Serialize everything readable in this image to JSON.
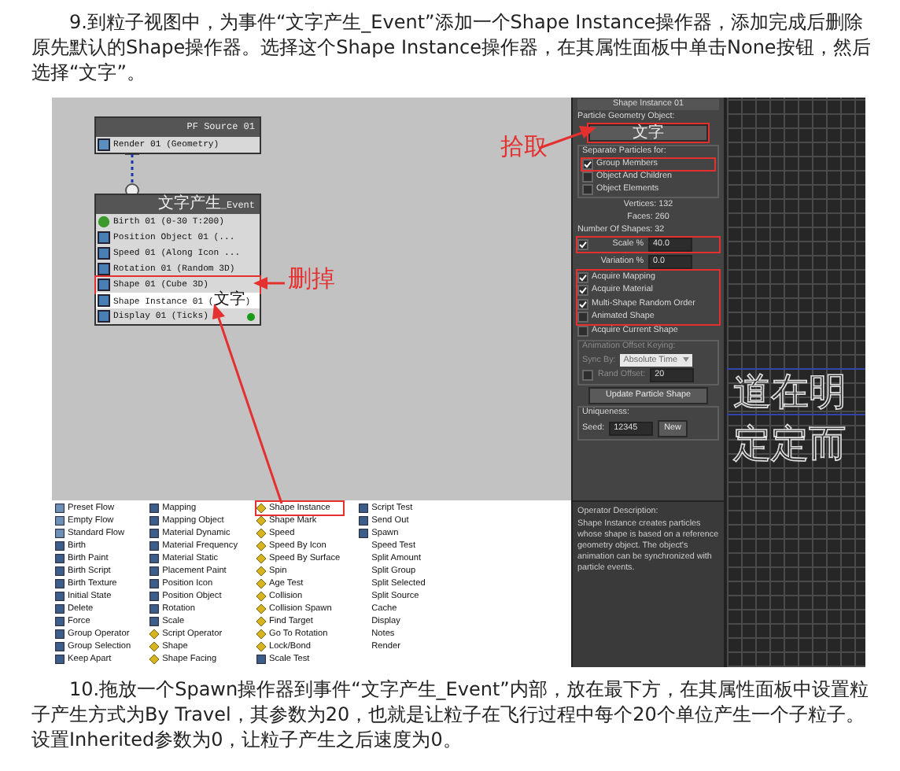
{
  "paragraphs": [
    "9.到粒子视图中，为事件“文字产生_Event”添加一个Shape Instance操作器，添加完成后删除原先默认的Shape操作器。选择这个Shape Instance操作器，在其属性面板中单击None按钮，然后选择“文字”。",
    "10.拖放一个Spawn操作器到事件“文字产生_Event”内部，放在最下方，在其属性面板中设置粒子产生方式为By Travel，其参数为20，也就是让粒子在飞行过程中每个20个单位产生一个子粒子。设置Inherited参数为0，让粒子产生之后速度为0。"
  ],
  "particle_view": {
    "nodes": [
      {
        "title": "PF Source 01",
        "operators": [
          {
            "label": "Render 01 (Geometry)",
            "kind": "render",
            "selected": false,
            "boxed": false
          }
        ]
      },
      {
        "title": "文字产生_Event",
        "operators": [
          {
            "label": "Birth 01 (0-30 T:200)",
            "kind": "birth",
            "selected": false,
            "boxed": false
          },
          {
            "label": "Position Object 01 (...",
            "kind": "operator",
            "selected": false,
            "boxed": false
          },
          {
            "label": "Speed 01 (Along Icon ...",
            "kind": "operator",
            "selected": false,
            "boxed": false
          },
          {
            "label": "Rotation 01 (Random 3D)",
            "kind": "operator",
            "selected": false,
            "boxed": false
          },
          {
            "label": "Shape 01 (Cube 3D)",
            "kind": "operator",
            "selected": false,
            "boxed": true
          },
          {
            "label": "Shape Instance 01 (文字)",
            "kind": "operator",
            "selected": true,
            "boxed": false
          },
          {
            "label": "Display 01 (Ticks)",
            "kind": "display",
            "selected": false,
            "boxed": false
          }
        ]
      }
    ]
  },
  "annotations": [
    "删掉",
    "拾取"
  ],
  "command_panel": {
    "rollout_title": "Shape Instance 01",
    "geometry_label": "Particle Geometry Object:",
    "geometry_button": {
      "label": "文字",
      "boxed": true
    },
    "separate_label": "Separate Particles for:",
    "separate_options": [
      {
        "label": "Group Members",
        "checked": true,
        "boxed": true
      },
      {
        "label": "Object And Children",
        "checked": false,
        "boxed": false
      },
      {
        "label": "Object Elements",
        "checked": false,
        "boxed": false
      }
    ],
    "stats": [
      "Vertices: 132",
      "Faces: 260"
    ],
    "shapes_label": "Number Of Shapes: 32",
    "spinners": [
      {
        "kind": "checked",
        "label": "Scale %",
        "checked": true,
        "value": "40.0",
        "boxed": true
      },
      {
        "kind": "plain",
        "label": "Variation %",
        "value": "0.0",
        "boxed": false
      }
    ],
    "acquire_boxed": true,
    "acquire_options": [
      {
        "label": "Acquire Mapping",
        "checked": true
      },
      {
        "label": "Acquire Material",
        "checked": true
      },
      {
        "label": "Multi-Shape Random Order",
        "checked": true
      },
      {
        "label": "Animated Shape",
        "checked": false
      }
    ],
    "current_option": {
      "label": "Acquire Current Shape",
      "checked": false
    },
    "offset_group": {
      "label": "Animation Offset Keying:",
      "disabled": true,
      "sync_label": "Sync By:",
      "sync_value": "Absolute Time",
      "rand_label": "Rand Offset:",
      "rand_checked": false,
      "rand_value": "20"
    },
    "update_button": "Update Particle Shape",
    "uniqueness": {
      "label": "Uniqueness:",
      "seed_label": "Seed:",
      "seed_value": "12345",
      "new_button": "New"
    }
  },
  "description": {
    "title": "Operator Description:",
    "text": "Shape Instance creates particles whose shape is based on a reference geometry object. The object's animation can be synchronized with particle events."
  },
  "viewport": {
    "lines": [
      {
        "text": "道在明",
        "highlighted": true
      },
      {
        "text": "定定而",
        "highlighted": false
      }
    ]
  },
  "depot": {
    "items": [
      {
        "label": "Preset Flow",
        "kind": "flow",
        "boxed": false
      },
      {
        "label": "Empty Flow",
        "kind": "flow",
        "boxed": false
      },
      {
        "label": "Standard Flow",
        "kind": "flow",
        "boxed": false
      },
      {
        "label": "Birth",
        "kind": "operator",
        "boxed": false
      },
      {
        "label": "Birth Paint",
        "kind": "operator",
        "boxed": false
      },
      {
        "label": "Birth Script",
        "kind": "operator",
        "boxed": false
      },
      {
        "label": "Birth Texture",
        "kind": "operator",
        "boxed": false
      },
      {
        "label": "Initial State",
        "kind": "operator",
        "boxed": false
      },
      {
        "label": "Delete",
        "kind": "operator",
        "boxed": false
      },
      {
        "label": "Force",
        "kind": "operator",
        "boxed": false
      },
      {
        "label": "Group Operator",
        "kind": "operator",
        "boxed": false
      },
      {
        "label": "Group Selection",
        "kind": "operator",
        "boxed": false
      },
      {
        "label": "Keep Apart",
        "kind": "operator",
        "boxed": false
      },
      {
        "label": "Mapping",
        "kind": "operator",
        "boxed": false
      },
      {
        "label": "Mapping Object",
        "kind": "operator",
        "boxed": false
      },
      {
        "label": "Material Dynamic",
        "kind": "operator",
        "boxed": false
      },
      {
        "label": "Material Frequency",
        "kind": "operator",
        "boxed": false
      },
      {
        "label": "Material Static",
        "kind": "operator",
        "boxed": false
      },
      {
        "label": "Placement Paint",
        "kind": "operator",
        "boxed": false
      },
      {
        "label": "Position Icon",
        "kind": "operator",
        "boxed": false
      },
      {
        "label": "Position Object",
        "kind": "operator",
        "boxed": false
      },
      {
        "label": "Rotation",
        "kind": "operator",
        "boxed": false
      },
      {
        "label": "Scale",
        "kind": "operator",
        "boxed": false
      },
      {
        "label": "Script Operator",
        "kind": "test",
        "boxed": false
      },
      {
        "label": "Shape",
        "kind": "test",
        "boxed": false
      },
      {
        "label": "Shape Facing",
        "kind": "test",
        "boxed": false
      },
      {
        "label": "Shape Instance",
        "kind": "test",
        "boxed": true
      },
      {
        "label": "Shape Mark",
        "kind": "test",
        "boxed": false
      },
      {
        "label": "Speed",
        "kind": "test",
        "boxed": false
      },
      {
        "label": "Speed By Icon",
        "kind": "test",
        "boxed": false
      },
      {
        "label": "Speed By Surface",
        "kind": "test",
        "boxed": false
      },
      {
        "label": "Spin",
        "kind": "test",
        "boxed": false
      },
      {
        "label": "Age Test",
        "kind": "test",
        "boxed": false
      },
      {
        "label": "Collision",
        "kind": "test",
        "boxed": false
      },
      {
        "label": "Collision Spawn",
        "kind": "test",
        "boxed": false
      },
      {
        "label": "Find Target",
        "kind": "test",
        "boxed": false
      },
      {
        "label": "Go To Rotation",
        "kind": "test",
        "boxed": false
      },
      {
        "label": "Lock/Bond",
        "kind": "test",
        "boxed": false
      },
      {
        "label": "Scale Test",
        "kind": "operator",
        "boxed": false
      },
      {
        "label": "Script Test",
        "kind": "operator",
        "boxed": false
      },
      {
        "label": "Send Out",
        "kind": "operator",
        "boxed": false
      },
      {
        "label": "Spawn",
        "kind": "operator",
        "boxed": false
      },
      {
        "label": "Speed Test",
        "kind": "plain",
        "boxed": false
      },
      {
        "label": "Split Amount",
        "kind": "plain",
        "boxed": false
      },
      {
        "label": "Split Group",
        "kind": "plain",
        "boxed": false
      },
      {
        "label": "Split Selected",
        "kind": "plain",
        "boxed": false
      },
      {
        "label": "Split Source",
        "kind": "plain",
        "boxed": false
      },
      {
        "label": "Cache",
        "kind": "plain",
        "boxed": false
      },
      {
        "label": "Display",
        "kind": "plain",
        "boxed": false
      },
      {
        "label": "Notes",
        "kind": "plain",
        "boxed": false
      },
      {
        "label": "Render",
        "kind": "plain",
        "boxed": false
      }
    ]
  }
}
